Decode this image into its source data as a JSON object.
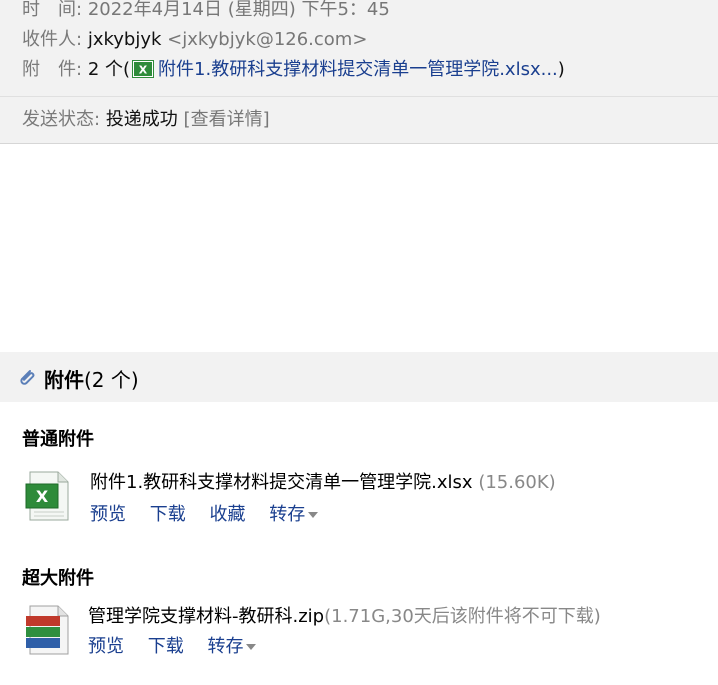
{
  "header": {
    "time_label": "时　间:",
    "time_value": "2022年4月14日 (星期四) 下午5：45",
    "recipient_label": "收件人:",
    "recipient_name": "jxkybjyk",
    "recipient_email": "<jxkybjyk@126.com>",
    "attachment_label": "附　件:",
    "attachment_count": "2 个",
    "attachment_open_paren": "(",
    "attachment_preview_name": "附件1.教研科支撑材料提交清单一管理学院.xlsx...",
    "attachment_close_paren": ")",
    "status_label": "发送状态:",
    "status_value": "投递成功",
    "status_details": "[查看详情]"
  },
  "attachments": {
    "title": "附件",
    "count": "(2 个)",
    "normal_title": "普通附件",
    "large_title": "超大附件",
    "normal": {
      "name": "附件1.教研科支撑材料提交清单一管理学院.xlsx",
      "size": "(15.60K)",
      "actions": [
        "预览",
        "下载",
        "收藏",
        "转存"
      ]
    },
    "large": {
      "name": "管理学院支撑材料-教研科.zip",
      "size": "(1.71G,30天后该附件将不可下载)",
      "actions": [
        "预览",
        "下载",
        "转存"
      ]
    }
  },
  "icons": {
    "clip": "paperclip-icon",
    "excel": "excel-file-icon",
    "zip": "zip-archive-icon"
  },
  "colors": {
    "link": "#1a3f8f",
    "header_bg": "#f2f2f2",
    "excel_green": "#2e8b3a"
  }
}
